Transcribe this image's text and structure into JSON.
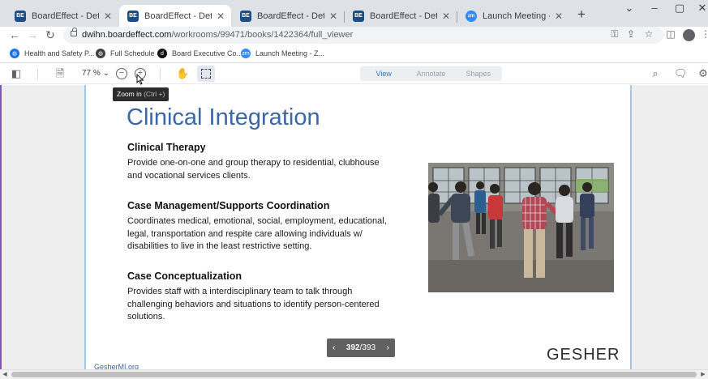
{
  "browser": {
    "tabs": [
      {
        "label": "BoardEffect - Detroit Wa",
        "favicon": "BE",
        "active": false
      },
      {
        "label": "BoardEffect - Detroit Wa",
        "favicon": "BE",
        "active": true
      },
      {
        "label": "BoardEffect - Detroit Wa",
        "favicon": "BE",
        "active": false
      },
      {
        "label": "BoardEffect - Detroit Wa",
        "favicon": "BE",
        "active": false
      },
      {
        "label": "Launch Meeting - Zoom",
        "favicon": "zm",
        "active": false
      }
    ],
    "new_tab": "+",
    "url_host": "dwihn.boardeffect.com",
    "url_path": "/workrooms/99471/books/1422364/full_viewer",
    "bookmarks": [
      {
        "label": "Health and Safety P...",
        "icon": "globe-icon",
        "color": "#1a73e8",
        "glyph": ""
      },
      {
        "label": "Full Schedule",
        "icon": "globe-icon",
        "color": "#3c4043",
        "glyph": ""
      },
      {
        "label": "Board Executive Co...",
        "icon": "doc-icon",
        "color": "#111111",
        "glyph": "d"
      },
      {
        "label": "Launch Meeting - Z...",
        "icon": "zoom-icon",
        "color": "#2d8cff",
        "glyph": "zm"
      }
    ]
  },
  "viewer": {
    "zoom": "77 %",
    "modes": [
      "View",
      "Annotate",
      "Shapes"
    ],
    "active_mode": "View",
    "tooltip_label": "Zoom in",
    "tooltip_shortcut": "(Ctrl +)"
  },
  "slide": {
    "title": "Clinical Integration",
    "sections": [
      {
        "heading": "Clinical Therapy",
        "lines": [
          "Provide one-on-one and group therapy to residential, clubhouse",
          "and vocational services clients."
        ]
      },
      {
        "heading": "Case Management/Supports Coordination",
        "lines": [
          "Coordinates medical, emotional, social, employment, educational,",
          "legal, transportation and respite care allowing individuals w/",
          "disabilities to live in the least restrictive setting."
        ]
      },
      {
        "heading": "Case Conceptualization",
        "lines": [
          "Provides staff with a interdisciplinary team to talk through",
          "challenging behaviors and situations to identify person-centered",
          "solutions."
        ]
      }
    ],
    "logo": "GESHER",
    "footer_link": "GesherMI.org"
  },
  "pager": {
    "current": "392",
    "total": "393",
    "sep": "/"
  },
  "colors": {
    "title": "#3a67a6",
    "page_border": "#9ec9e2",
    "accent": "#3b6fb6"
  }
}
